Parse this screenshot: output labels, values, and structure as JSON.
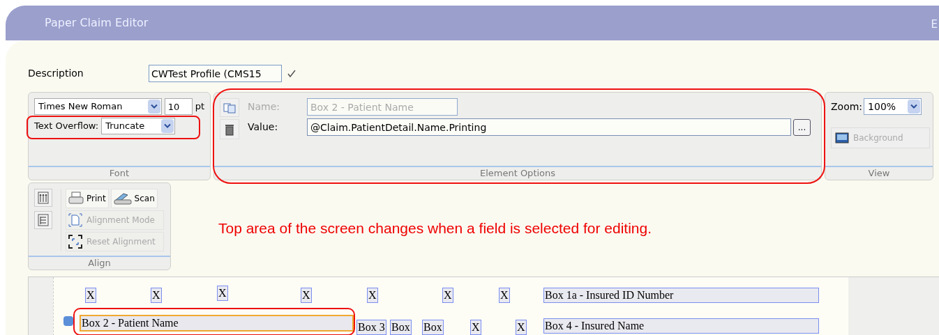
{
  "window": {
    "title": "Paper Claim Editor",
    "title_right": "E"
  },
  "description": {
    "label": "Description",
    "value": "CWTest Profile (CMS15"
  },
  "font_group": {
    "title": "Font",
    "font_family": "Times New Roman",
    "font_size": "10",
    "size_unit": "pt",
    "overflow_label": "Text Overflow:",
    "overflow_value": "Truncate"
  },
  "element_options": {
    "title": "Element Options",
    "name_label": "Name:",
    "name_value": "Box 2 - Patient Name",
    "name_disabled": true,
    "value_label": "Value:",
    "value": "@Claim.PatientDetail.Name.Printing",
    "browse_button": "..."
  },
  "view": {
    "title": "View",
    "zoom_label": "Zoom:",
    "zoom_value": "100%",
    "background_button": "Background",
    "background_disabled": true
  },
  "align": {
    "title": "Align",
    "buttons": [
      {
        "label": "Print",
        "kind": "print",
        "disabled": false
      },
      {
        "label": "Scan",
        "kind": "scan",
        "disabled": false
      },
      {
        "label": "Alignment Mode",
        "kind": "mode",
        "disabled": true
      },
      {
        "label": "Reset Alignment",
        "kind": "reset",
        "disabled": true
      }
    ]
  },
  "annotation": "Top area of the screen changes when a field is selected for editing.",
  "canvas": {
    "rows": [
      {
        "fields": [
          {
            "text": "X",
            "selected": false
          },
          {
            "text": "X",
            "selected": false
          },
          {
            "text": "X",
            "selected": false
          },
          {
            "text": "X",
            "selected": false
          },
          {
            "text": "X",
            "selected": false
          },
          {
            "text": "X",
            "selected": false
          },
          {
            "text": "X",
            "selected": false
          },
          {
            "text": "Box 1a - Insured ID Number",
            "selected": false
          }
        ]
      },
      {
        "fields": [
          {
            "text": "Box 2 - Patient Name",
            "selected": true
          },
          {
            "text": "Box 3",
            "selected": false
          },
          {
            "text": "Box",
            "selected": false
          },
          {
            "text": "Box",
            "selected": false
          },
          {
            "text": "X",
            "selected": false
          },
          {
            "text": "X",
            "selected": false
          },
          {
            "text": "Box 4 - Insured Name",
            "selected": false
          }
        ]
      }
    ]
  }
}
